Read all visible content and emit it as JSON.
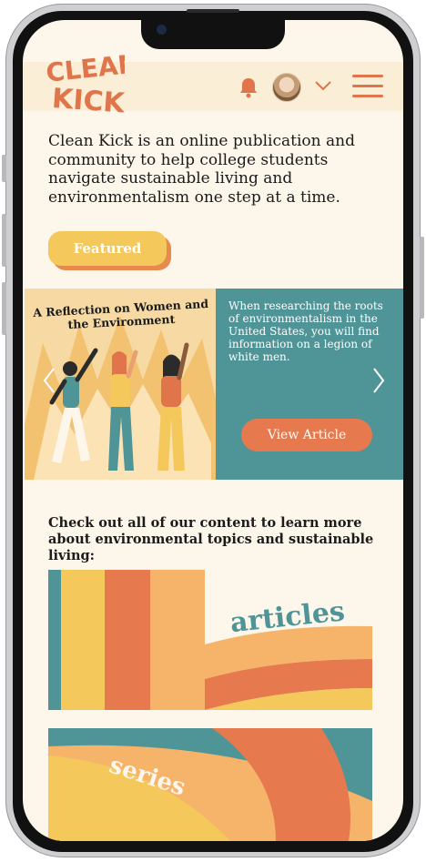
{
  "brand": {
    "logo_text": "CLEAN KICK"
  },
  "header": {
    "notification_icon": "bell-icon",
    "avatar": "user-avatar",
    "dropdown_icon": "chevron-down-icon",
    "menu_icon": "hamburger-menu-icon"
  },
  "intro": {
    "text": "Clean Kick is an online publication and community to help college students navigate sustainable living and environmentalism one step at a time."
  },
  "featured": {
    "label": "Featured"
  },
  "carousel": {
    "image_title": "A Reflection on Women and the Environment",
    "description": "When researching the roots of environmentalism in the United States, you will find information on a legion of white men.",
    "button_label": "View Article",
    "prev_icon": "chevron-left-icon",
    "next_icon": "chevron-right-icon"
  },
  "cta": {
    "text": "Check out all of our content to learn more about environmental topics and sustainable living:"
  },
  "cards": [
    {
      "label": "articles"
    },
    {
      "label": "series"
    }
  ],
  "colors": {
    "accent": "#e67a4e",
    "yellow": "#f4c85a",
    "teal": "#4f9497",
    "background": "#fdf6ea",
    "header": "#fbeed6"
  }
}
